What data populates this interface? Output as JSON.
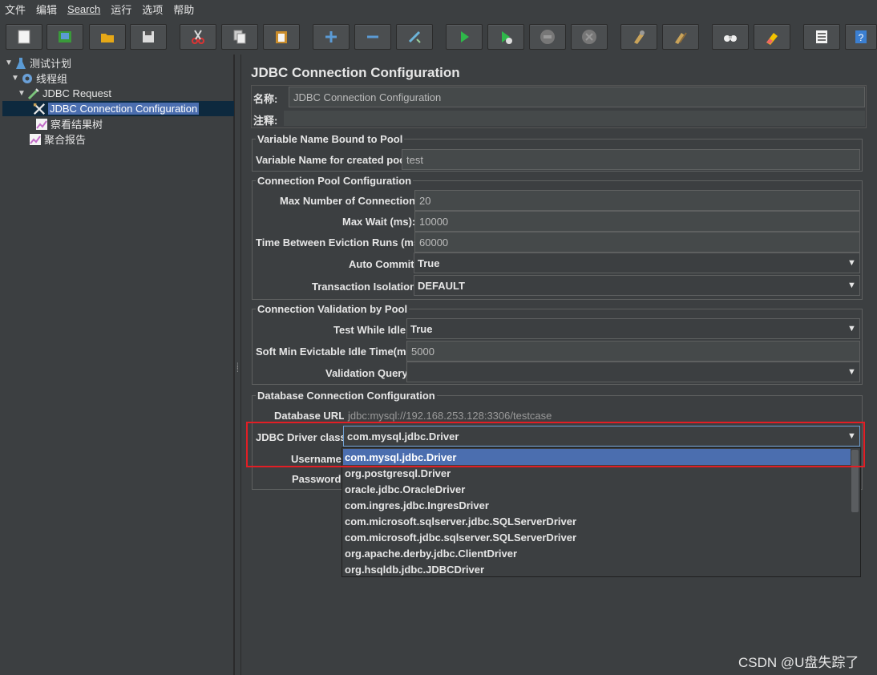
{
  "menu": [
    "文件",
    "编辑",
    "Search",
    "运行",
    "选项",
    "帮助"
  ],
  "tree": [
    {
      "label": "测试计划",
      "icon": "test-plan-icon"
    },
    {
      "label": "线程组",
      "icon": "gear-icon"
    },
    {
      "label": "JDBC Request",
      "icon": "pipette-icon"
    },
    {
      "label": "JDBC Connection Configuration",
      "icon": "crossed-tools-icon"
    },
    {
      "label": "察看结果树",
      "icon": "chart-icon"
    },
    {
      "label": "聚合报告",
      "icon": "chart-icon"
    }
  ],
  "panel": {
    "title": "JDBC Connection Configuration",
    "name_label": "名称:",
    "name_value": "JDBC Connection Configuration",
    "comment_label": "注释:",
    "comment_value": "",
    "vnbp": {
      "legend": "Variable Name Bound to Pool",
      "var_label": "Variable Name for created pool:",
      "var_value": "test"
    },
    "pool": {
      "legend": "Connection Pool Configuration",
      "max_conn_label": "Max Number of Connections:",
      "max_conn_value": "20",
      "max_wait_label": "Max Wait (ms):",
      "max_wait_value": "10000",
      "evict_label": "Time Between Eviction Runs (ms):",
      "evict_value": "60000",
      "auto_commit_label": "Auto Commit:",
      "auto_commit_value": "True",
      "isolation_label": "Transaction Isolation:",
      "isolation_value": "DEFAULT"
    },
    "validation": {
      "legend": "Connection Validation by Pool",
      "idle_label": "Test While Idle:",
      "idle_value": "True",
      "soft_label": "Soft Min Evictable Idle Time(ms):",
      "soft_value": "5000",
      "query_label": "Validation Query:",
      "query_value": ""
    },
    "db": {
      "legend": "Database Connection Configuration",
      "url_label": "Database URL:",
      "url_value": "jdbc:mysql://192.168.253.128:3306/testcase",
      "driver_label": "JDBC Driver class:",
      "driver_value": "com.mysql.jdbc.Driver",
      "username_label": "Username:",
      "password_label": "Password:"
    },
    "driver_options": [
      "com.mysql.jdbc.Driver",
      "org.postgresql.Driver",
      "oracle.jdbc.OracleDriver",
      "com.ingres.jdbc.IngresDriver",
      "com.microsoft.sqlserver.jdbc.SQLServerDriver",
      "com.microsoft.jdbc.sqlserver.SQLServerDriver",
      "org.apache.derby.jdbc.ClientDriver",
      "org.hsqldb.jdbc.JDBCDriver"
    ]
  },
  "watermark": "CSDN @U盘失踪了",
  "colors": {
    "selection": "#4b6eaf",
    "highlight_box": "#e21e25",
    "background": "#3c3f41"
  }
}
